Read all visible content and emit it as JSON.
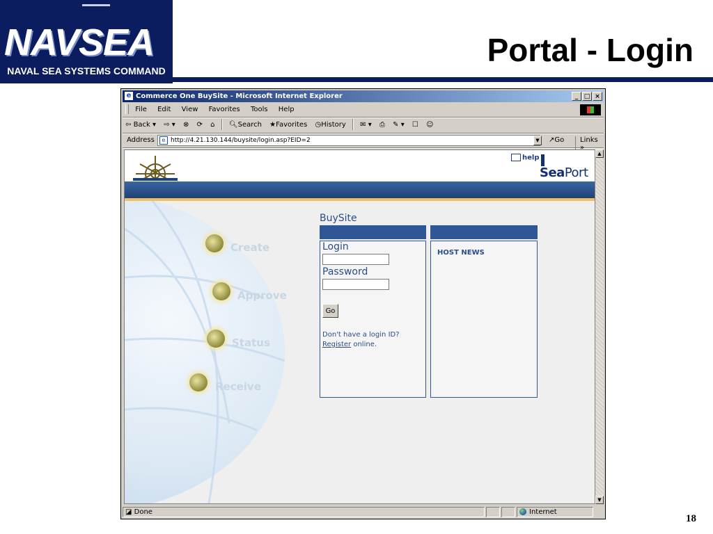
{
  "slide": {
    "logo_wordmark": "NAVSEA",
    "logo_subtitle": "NAVAL SEA SYSTEMS COMMAND",
    "title": "Portal - Login",
    "page_number": "18"
  },
  "browser": {
    "window_title": "Commerce One BuySite - Microsoft Internet Explorer",
    "menu": [
      "File",
      "Edit",
      "View",
      "Favorites",
      "Tools",
      "Help"
    ],
    "toolbar": {
      "back": "Back",
      "search": "Search",
      "favorites": "Favorites",
      "history": "History"
    },
    "address_label": "Address",
    "url": "http://4.21.130.144/buysite/login.asp?EID=2",
    "go_label": "Go",
    "links_label": "Links",
    "status_text": "Done",
    "zone_text": "Internet"
  },
  "site": {
    "help_label": "help",
    "brand_part1": "Sea",
    "brand_part2": "Port",
    "nav": [
      "Create",
      "Approve",
      "Status",
      "Receive"
    ],
    "buysite_title": "BuySite",
    "login_label": "Login",
    "password_label": "Password",
    "login_value": "",
    "password_value": "",
    "submit_label": "Go",
    "prompt": "Don't have a login ID?",
    "register_link": "Register",
    "register_suffix": " online.",
    "host_news_title": "HOST NEWS"
  }
}
